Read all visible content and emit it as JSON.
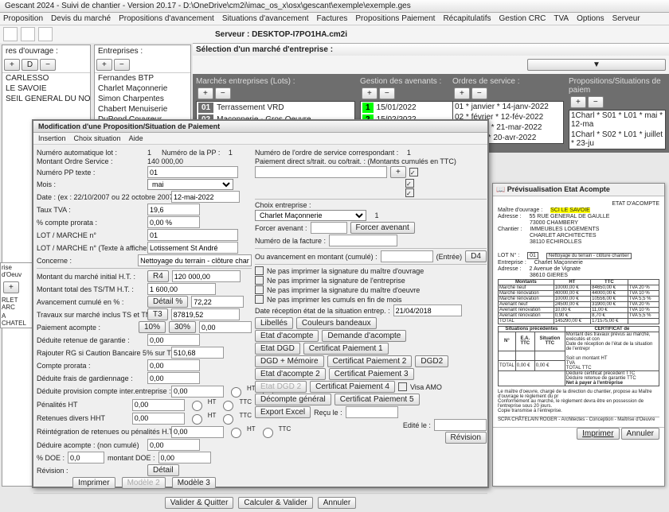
{
  "window_title": "Gescant 2024 - Suivi de chantier - Version 20.17 - D:\\OneDrive\\cm2i\\imac_os_x\\osx\\gescant\\exemple\\exemple.ges",
  "menus": [
    "Proposition",
    "Devis du marché",
    "Propositions d'avancement",
    "Situations d'avancement",
    "Factures",
    "Propositions Paiement",
    "Récapitulatifs",
    "Gestion CRC",
    "TVA",
    "Options",
    "Serveur"
  ],
  "server_label": "Serveur : DESKTOP-I7PO1HA.cm2i",
  "cols": {
    "mo": {
      "hdr": "res d'ouvrage :",
      "items": [
        "CARLESSO",
        "LE SAVOIE",
        "SEIL GENERAL DU NORD"
      ]
    },
    "ent": {
      "hdr": "Entreprises :",
      "items": [
        "Fernandes BTP",
        "Charlet Maçonnerie",
        "Simon Charpentes",
        "Chabert Menuiserie",
        "DuPond Couvreur"
      ]
    }
  },
  "sel_header": "Sélection d'un marché d'entreprise :",
  "marches": {
    "hdr": "Marchés entreprises (Lots) :",
    "rows": [
      [
        "01",
        "Terrassement VRD"
      ],
      [
        "02",
        "Maçonnerie - Gros Oeuvre"
      ]
    ]
  },
  "avenants": {
    "hdr": "Gestion des avenants :",
    "rows": [
      [
        "1",
        "15/01/2022"
      ],
      [
        "2",
        "15/02/2022"
      ]
    ]
  },
  "os": {
    "hdr": "Ordres de service :",
    "rows": [
      "01 * janvier * 14-janv-2022",
      "02 * février * 12-fév-2022",
      "03 * mars * 21-mar-2022",
      "04 * avril * 20-avr-2022"
    ]
  },
  "props": {
    "hdr": "Propositions/Situations de paiem",
    "rows": [
      "1Charl * S01 * L01 * mai * 12-ma",
      "1Charl * S02 * L01 * juillet * 23-ju"
    ]
  },
  "lstrip": {
    "hdr": "rise d'Oeuv",
    "items": [
      "RLET ARC",
      "A CHATEL"
    ]
  },
  "dialog": {
    "title": "Modification d'une Proposition/Situation de Paiement",
    "menus": [
      "Insertion",
      "Choix situation",
      "Aide"
    ],
    "auto_lot": "Numéro automatique lot :",
    "auto_lot_v": "1",
    "num_pp": "Numéro de la PP :",
    "num_pp_v": "1",
    "montant_os": "Montant Ordre Service :",
    "montant_os_v": "140 000,00",
    "num_pp_txt": "Numéro PP texte :",
    "num_pp_txt_v": "01",
    "mois": "Mois :",
    "mois_v": "mai",
    "date_hint": "Date : (ex : 22/10/2007 ou 22 octobre 2007) :",
    "date_v": "12-mai-2022",
    "taux_tva": "Taux TVA :",
    "taux_tva_v": "19,6",
    "compte_pr": "% compte prorata :",
    "compte_pr_v": "0,00 %",
    "lot_marche": "LOT / MARCHE n°",
    "lot_marche_v": "01",
    "lot_txt": "LOT / MARCHE n° (Texte à afficher) :",
    "lot_txt_v": "Lotissement St André",
    "concerne": "Concerne :",
    "concerne_v": "Nettoyage du terrain - clôture chantier",
    "marche_ht": "Montant du marché initial H.T. :",
    "r4": "R4",
    "marche_ht_v": "120 000,00",
    "total_ts": "Montant total des TS/TM H.T. :",
    "total_ts_v": "1 600,00",
    "avance": "Avancement cumulé en % :",
    "detail": "Détail %",
    "avance_v": "72,22",
    "trav_marche": "Travaux sur marché inclus TS et TM :",
    "t3": "T3",
    "trav_marche_v": "87819,52",
    "acompte": "Paiement acompte :",
    "b10": "10%",
    "b30": "30%",
    "acompte_v": "0,00",
    "dedgar": "Déduite retenue de garantie :",
    "dedgar_v": "0,00",
    "rajrg": "Rajouter RG si Caution Bancaire 5% sur T3 :",
    "rajrg_v": "510,68",
    "cprorata": "Compte prorata :",
    "cprorata_v": "0,00",
    "frais": "Déduite frais de gardiennage :",
    "frais_v": "0,00",
    "provinter": "Déduite provision compte inter.entreprise :",
    "provinter_v": "0,00",
    "pen": "Pénalités HT",
    "pen_v": "0,00",
    "retdiv": "Retenues divers HHT",
    "retdiv_v": "0,00",
    "reint": "Réintégration de retenues ou pénalités H.T. :",
    "reint_v": "0,00",
    "dedac": "Déduire acompte : (non cumulé)",
    "dedac_v": "0,00",
    "doe": "% DOE :",
    "doe_v": "0,0",
    "doe_mont": "montant DOE :",
    "doe_mont_v": "0,00",
    "rev": "Révision :",
    "num_os": "Numéro de l'ordre de service correspondant :",
    "num_os_v": "1",
    "paiement_hdr": "Paiement direct s/trait. ou co/trait. : (Montants cumulés en TTC)",
    "choix_ent": "Choix entreprise :",
    "choix_ent_v": "Charlet Maçonnerie",
    "choix_ent_n": "1",
    "forcer": "Forcer avenant :",
    "forcer_btn": "Forcer avenant",
    "num_fact": "Numéro de la facture :",
    "ou_avance": "Ou avancement en montant (cumulé) :",
    "entree": "(Entrée)",
    "d4": "D4",
    "chk1": "Ne pas imprimer la signature du maître d'ouvrage",
    "chk2": "Ne pas imprimer la signature de l'entreprise",
    "chk3": "Ne pas imprimer la signature du maître d'oeuvre",
    "chk4": "Ne pas imprimer les cumuls en fin de mois",
    "date_recep": "Date réception état de la situation entrep. :",
    "date_recep_v": "21/04/2018",
    "btns": {
      "libelles": "Libellés",
      "couleurs": "Couleurs bandeaux",
      "etat_ac": "Etat d'acompte",
      "demande": "Demande d'acompte",
      "dgd": "Etat DGD",
      "cert1": "Certificat Paiement 1",
      "dgdmem": "DGD + Mémoire",
      "cert2": "Certificat Paiement 2",
      "dgd2": "DGD2",
      "etat_ac2": "Etat d'acompte 2",
      "cert3": "Certificat Paiement 3",
      "etatdgd2": "Etat DGD 2",
      "cert4": "Certificat Paiement 4",
      "visa": "Visa AMO",
      "decgen": "Décompte général",
      "cert5": "Certificat Paiement 5",
      "export": "Export Excel",
      "recu": "Reçu le :",
      "edite": "Edité le :"
    },
    "foot": {
      "valquit": "Valider & Quitter",
      "calcval": "Calculer & Valider",
      "annuler": "Annuler",
      "imprimer": "Imprimer",
      "modele2": "Modèle 2",
      "modele3": "Modèle 3",
      "revision": "Révision",
      "detailbtn": "Détail"
    },
    "ht_ttc": {
      "ht": "HT",
      "ttc": "TTC"
    }
  },
  "prev": {
    "title": "Prévisualisation Etat Acompte",
    "doc_title": "ETAT D'ACOMPTE",
    "mo_lbl": "Maître d'ouvrage :",
    "mo_v": "SCI LE SAVOIE",
    "addr_lbl": "Adresse :",
    "addr": [
      "55 RUE GENERAL DE GAULLE",
      "73000 CHAMBERY"
    ],
    "chantier_lbl": "Chantier :",
    "chantier": [
      "IMMEUBLES LOGEMENTS",
      "CHARLET ARCHITECTES",
      "38110 ECHIROLLES"
    ],
    "lot_lbl": "LOT N° :",
    "lot_v": "01",
    "lot_desc": "Nettoyage du terrain - clôture chantier",
    "ent_lbl": "Entreprise :",
    "ent_v": "Charlet Maçonnerie",
    "ent_addr": [
      "2 Avenue de Vignate",
      "38610 GIERES"
    ],
    "tbl_hdr": [
      "Montants",
      "HT",
      "TTC",
      ""
    ],
    "rows": [
      [
        "Marché neuf",
        "10000,00 €",
        "84650,00 €",
        "TVA 20 %"
      ],
      [
        "Marché rénovation",
        "40000,00 €",
        "44000,00 €",
        "TVA 10 %"
      ],
      [
        "Marché rénovation",
        "10000,00 €",
        "10556,00 €",
        "TVA 5,5 %"
      ],
      [
        "Avenant neuf",
        "24500,00 €",
        "31900,00 €",
        "TVA 20 %"
      ],
      [
        "Avenant rénovation",
        "10,00 €",
        "11,00 €",
        "TVA 10 %"
      ],
      [
        "Avenant rénovation",
        "0,90 €",
        "8,70 €",
        "TVA 5,5 %"
      ],
      [
        "TOTAL",
        "145290,00 €",
        "171575,00 €",
        ""
      ]
    ],
    "sit_prec": "Situations précédentes",
    "certif": "CERTIFICAT de",
    "sit_hdr": [
      "N°",
      "E.A. TTC",
      "Situation TTC"
    ],
    "mid": [
      "Montant des travaux prévus au marché, exécutés et con",
      "Date de réception de l'état de la situation de l'entrepr"
    ],
    "soit": "Soit un montant HT",
    "tva_l": "TVA",
    "total_ttc": "TOTAL TTC",
    "tot_row": [
      "TOTAL",
      "0,00 €",
      "0,00 €"
    ],
    "ded_prev": "Déduire certificat précédent TTC",
    "ded_ret": "Déduire retenue de garantie TTC",
    "net": "Net à payer à l'entreprise",
    "footer": [
      "Le maître d'oeuvre, chargé de la direction du chantier, propose au Maître d'ouvrage le règlement du pr",
      "Conformément au marché, le règlement devra être en possession de l'entreprise sous 20 jours.",
      "Copie transmise à l'entreprise."
    ],
    "sign": "SCPA CHÂTELAIN ROGER - Architectes - Conception - Maîtrise d'Oeuvre",
    "imprimer": "Imprimer",
    "annuler": "Annuler"
  }
}
